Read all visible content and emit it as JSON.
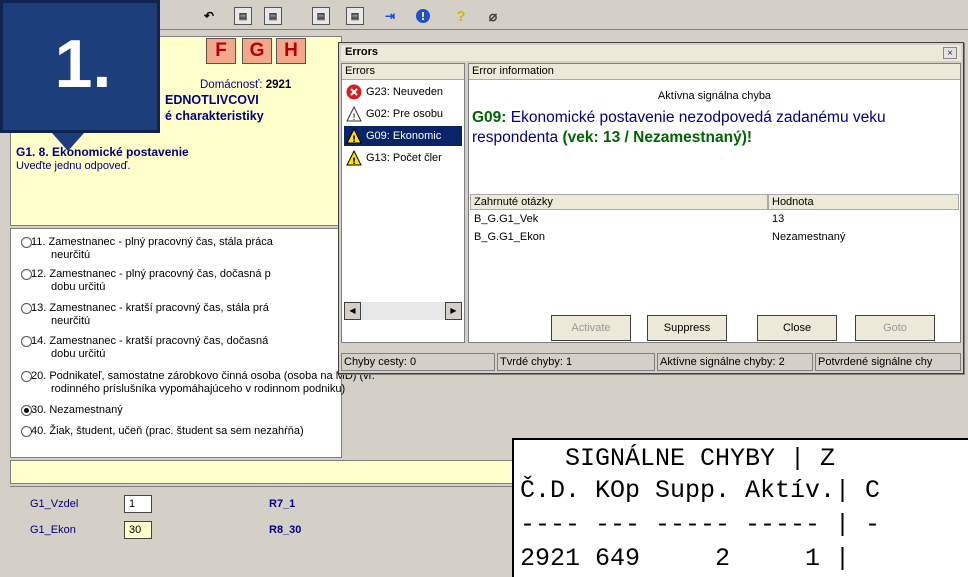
{
  "toolbar": {
    "icons": [
      "undo-icon",
      "window-icon",
      "window-icon",
      "window-icon",
      "window-icon",
      "exit-icon",
      "info-icon",
      "help-icon",
      "attach-icon"
    ]
  },
  "form": {
    "tabs": [
      "F",
      "G",
      "H"
    ],
    "household_label": "Domácnosť:",
    "household_value": "2921",
    "section_a": "EDNOTLIVCOVI",
    "section_b": "é charakteristiky",
    "question_title": "G1. 8. Ekonomické postavenie",
    "instruction": "Uveďte jednu odpoveď."
  },
  "options": [
    {
      "line1": "11.  Zamestnanec - plný pracovný čas, stála práca",
      "line2": "neurčitú",
      "selected": false
    },
    {
      "line1": "12.  Zamestnanec - plný pracovný čas, dočasná p",
      "line2": "dobu určitú",
      "selected": false
    },
    {
      "line1": "13.  Zamestnanec - kratší pracovný čas, stála prá",
      "line2": "neurčitú",
      "selected": false
    },
    {
      "line1": "14.  Zamestnanec - kratší pracovný čas, dočasná",
      "line2": "dobu určitú",
      "selected": false
    },
    {
      "line1": "20.  Podnikateľ, samostatne zárobkovo činná osoba (osoba na MD) (vr.",
      "line2": "rodinného príslušníka vypomáhajúceho v rodinnom podniku)",
      "selected": false
    },
    {
      "line1": "30.  Nezamestnaný",
      "line2": "",
      "selected": true
    },
    {
      "line1": "40.  Žiak, študent, učeň (prac. študent sa sem nezahŕňa)",
      "line2": "",
      "selected": false
    }
  ],
  "variables": [
    {
      "name": "G1_Vzdel",
      "value": "1",
      "code": "R7_1"
    },
    {
      "name": "G1_Ekon",
      "value": "30",
      "code": "R8_30"
    }
  ],
  "badge": {
    "text": "1."
  },
  "dialog": {
    "title": "Errors",
    "close": "×",
    "list_header": "Errors",
    "errors": [
      {
        "icon": "error-icon",
        "text": "G23: Neuveden"
      },
      {
        "icon": "warning-outline-icon",
        "text": "G02: Pre osobu"
      },
      {
        "icon": "warning-icon",
        "text": "G09: Ekonomic",
        "selected": true
      },
      {
        "icon": "warning-icon",
        "text": "G13: Počet čler"
      }
    ],
    "info_header": "Error information",
    "info_subtitle": "Aktívna signálna chyba",
    "message_code": "G09:",
    "message_text": " Ekonomické postavenie nezodpovedá zadanému veku respondenta ",
    "message_detail": "(vek: 13 /  Nezamestnaný)!",
    "grid_headers": [
      "Zahrnuté otázky",
      "Hodnota"
    ],
    "grid_rows": [
      [
        "B_G.G1_Vek",
        "13"
      ],
      [
        "B_G.G1_Ekon",
        "Nezamestnaný"
      ]
    ],
    "buttons": {
      "activate": "Activate",
      "suppress": "Suppress",
      "close": "Close",
      "goto": "Goto"
    },
    "status": [
      "Chyby cesty: 0",
      "Tvrdé chyby: 1",
      "Aktívne signálne chyby: 2",
      "Potvrdené signálne chy"
    ]
  },
  "console": {
    "lines": [
      "   SIGNÁLNE CHYBY | Z",
      "Č.D. KOp Supp. Aktív.| C",
      "---- --- ----- ----- | -",
      "2921 649     2     1 |"
    ]
  }
}
